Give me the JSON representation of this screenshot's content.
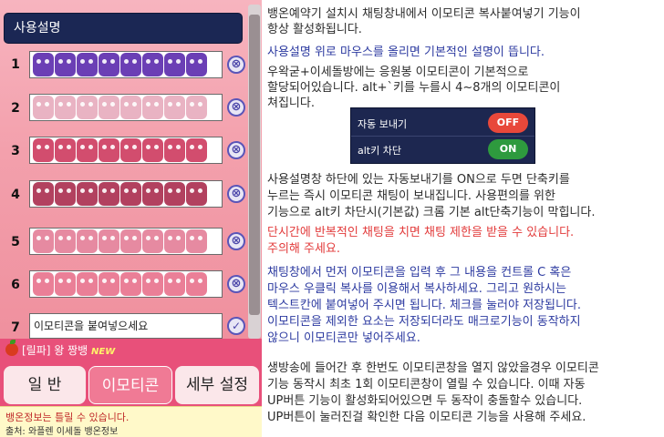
{
  "left_panel": {
    "manual_label": "사용설명",
    "slots": [
      {
        "num": "1",
        "emote_color": "#6b3fb5",
        "count": 8
      },
      {
        "num": "2",
        "emote_color": "#e9b3c3",
        "count": 8
      },
      {
        "num": "3",
        "emote_color": "#d24d6e",
        "count": 8
      },
      {
        "num": "4",
        "emote_color": "#b2415f",
        "count": 8
      },
      {
        "num": "5",
        "emote_color": "#e68aa1",
        "count": 8
      },
      {
        "num": "6",
        "emote_color": "#ea7f97",
        "count": 8
      },
      {
        "num": "7"
      }
    ],
    "delete_symbol": "⊗",
    "check_symbol": "✓",
    "input_placeholder": "이모티콘을 붙여넣으세요",
    "notice_text": "[릴파] 왕 짱뱅",
    "new_badge": "NEW",
    "tabs": {
      "general": "일 반",
      "emoticon": "이모티콘",
      "settings": "세부 설정"
    },
    "footer_line1": "뱅온정보는 틀릴 수 있습니다.",
    "footer_line2": "출처: 와플렌 이세돌 뱅온정보"
  },
  "help": {
    "para1_line1": "뱅온예약기 설치시 채팅창내에서 이모티콘 복사붙여넣기 기능이",
    "para1_line2": "항상 활성화됩니다.",
    "para2": "사용설명 위로 마우스를 올리면 기본적인 설명이 뜹니다.",
    "para3_line1": "우왁굳+이세돌방에는 응원봉 이모티콘이 기본적으로",
    "para3_line2": "할당되어있습니다. alt+`키를 누를시 4~8개의 이모티콘이",
    "para3_line3": "쳐집니다.",
    "toggle_auto_send": "자동 보내기",
    "toggle_auto_send_state": "OFF",
    "toggle_alt_block": "alt키 차단",
    "toggle_alt_block_state": "ON",
    "para4_line1": "사용설명창 하단에 있는 자동보내기를 ON으로 두면 단축키를",
    "para4_line2": "누르는 즉시 이모티콘 채팅이 보내집니다. 사용편의를 위한",
    "para4_line3": "기능으로 alt키 차단시(기본값) 크롬 기본 alt단축기능이 막힙니다.",
    "para5_line1": "단시간에 반복적인 채팅을 치면 채팅 제한을 받을 수 있습니다.",
    "para5_line2": "주의해 주세요.",
    "para6_line1": "채팅창에서 먼저 이모티콘을 입력 후 그 내용을 컨트롤 C 혹은",
    "para6_line2": "마우스 우클릭 복사를 이용해서 복사하세요. 그리고 원하시는",
    "para6_line3": "텍스트칸에 붙여넣어 주시면 됩니다. 체크를 눌러야 저장됩니다.",
    "para6_line4": "이모티콘을 제외한 요소는 저장되더라도 매크로기능이 동작하지",
    "para6_line5": "않으니 이모티콘만 넣어주세요.",
    "para7_line1": "생방송에 들어간 후 한번도 이모티콘창을 열지 않았을경우 이모티콘",
    "para7_line2": "기능 동작시 최초 1회 이모티콘창이 열릴 수 있습니다. 이때 자동",
    "para7_line3": "UP버튼 기능이 활성화되어있으면 두 동작이 충돌할수 있습니다.",
    "para7_line4": "UP버튼이 눌러진걸 확인한 다음 이모티콘 기능을 사용해 주세요."
  },
  "colors": {
    "panel_pink": "#f2a0ab",
    "nav_dark": "#1b2754",
    "tab_active": "#f07a95",
    "text_blue": "#2c3aa0",
    "text_red": "#e23a3a",
    "toggle_off": "#e8483a",
    "toggle_on": "#2e9a3e"
  }
}
